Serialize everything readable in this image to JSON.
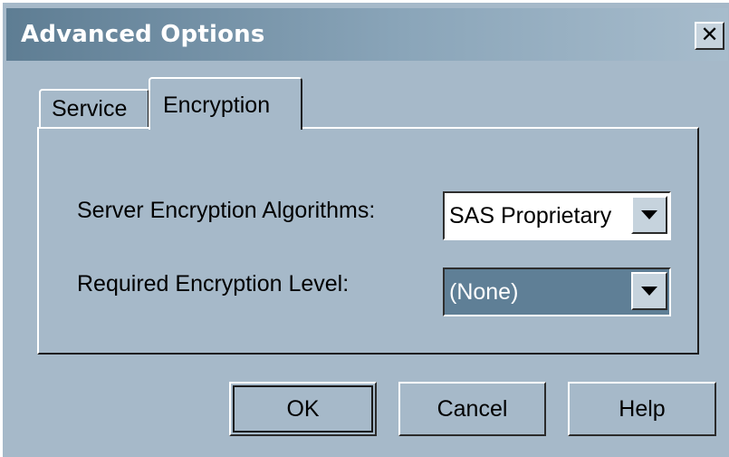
{
  "window": {
    "title": "Advanced Options",
    "close_label": "x"
  },
  "tabs": [
    {
      "label": "Service",
      "active": false
    },
    {
      "label": "Encryption",
      "active": true
    }
  ],
  "fields": {
    "algorithms": {
      "label": "Server Encryption Algorithms:",
      "value": "SAS Proprietary"
    },
    "level": {
      "label": "Required Encryption Level:",
      "value": "(None)"
    }
  },
  "buttons": {
    "ok": "OK",
    "cancel": "Cancel",
    "help": "Help"
  },
  "colors": {
    "dialog_bg": "#a6b9c9",
    "titlebar_start": "#5e7d93",
    "selected_field_bg": "#5f7f96"
  }
}
